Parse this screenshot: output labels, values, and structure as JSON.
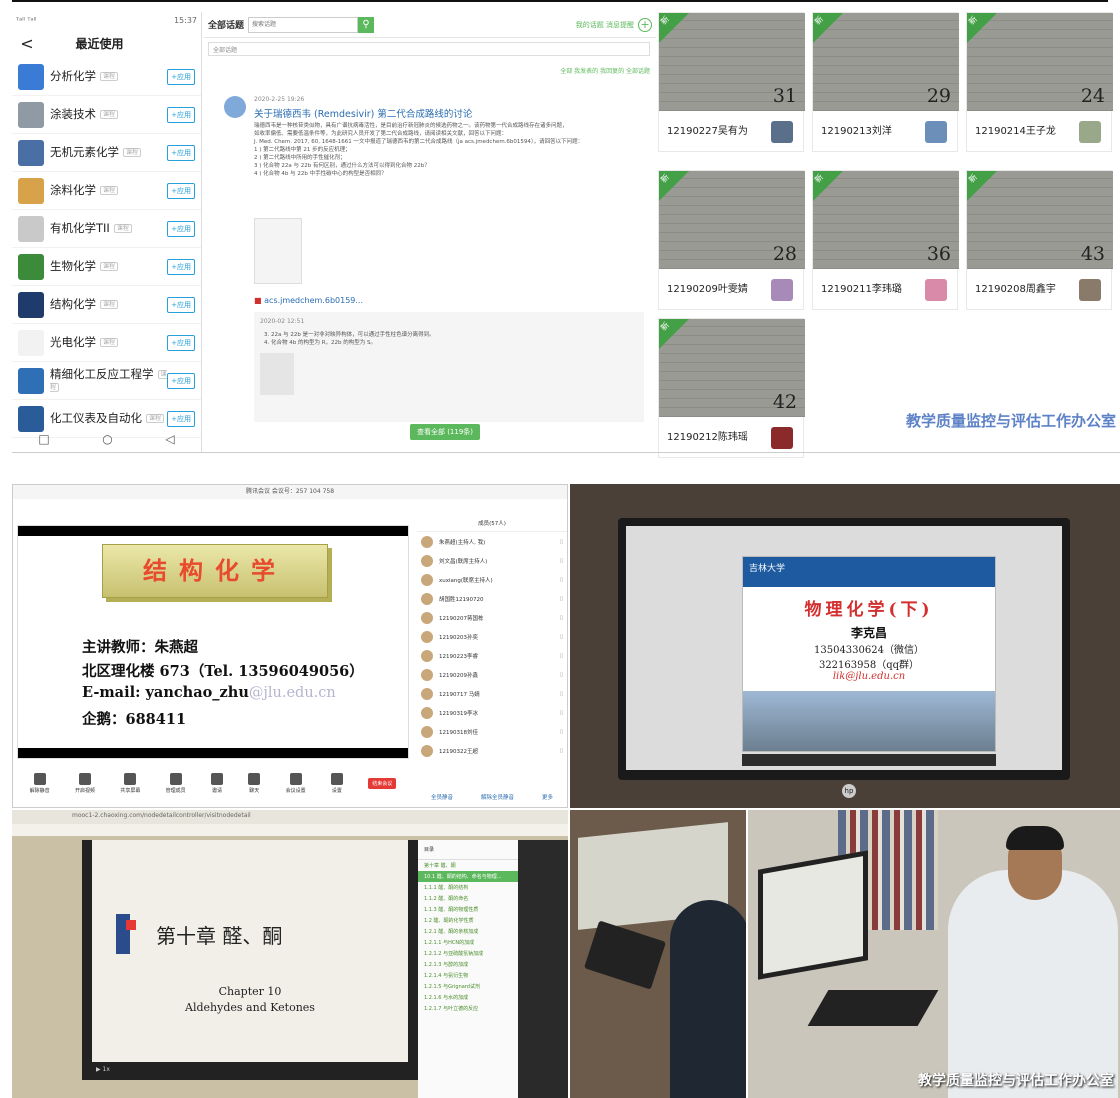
{
  "phone": {
    "status_left": "ᵀᵃˡˡ ᵀᵃˡˡ",
    "status_right": "15:37",
    "title": "最近使用",
    "back": "<",
    "items": [
      {
        "name": "分析化学",
        "tag": "课程",
        "button": "+应用",
        "color": "#3a7bd5"
      },
      {
        "name": "涂装技术",
        "tag": "课程",
        "button": "+应用",
        "color": "#8f9aa5"
      },
      {
        "name": "无机元素化学",
        "tag": "课程",
        "button": "+应用",
        "color": "#4a6fa5"
      },
      {
        "name": "涂料化学",
        "tag": "课程",
        "button": "+应用",
        "color": "#d8a24a"
      },
      {
        "name": "有机化学TII",
        "tag": "课程",
        "button": "+应用",
        "color": "#c9c9c9"
      },
      {
        "name": "生物化学",
        "tag": "课程",
        "button": "+应用",
        "color": "#3b8b3b"
      },
      {
        "name": "结构化学",
        "tag": "课程",
        "button": "+应用",
        "color": "#1f3b6b"
      },
      {
        "name": "光电化学",
        "tag": "课程",
        "button": "+应用",
        "color": "#f2f2f2"
      },
      {
        "name": "精细化工反应工程学",
        "tag": "课程",
        "button": "+应用",
        "color": "#2f6fb5"
      },
      {
        "name": "化工仪表及自动化",
        "tag": "课程",
        "button": "+应用",
        "color": "#2a5c9a"
      }
    ],
    "nav": [
      "□",
      "○",
      "◁"
    ]
  },
  "discussion": {
    "label": "全部话题",
    "search_placeholder": "搜索话题",
    "search_icon": "search-icon",
    "right_links": "我的话题  消息提醒",
    "sub_label": "全部话题",
    "filters": "全部  我发表的  我回复的  全部话题",
    "post": {
      "meta": "2020-2-25 19:26",
      "title": "关于瑞德西韦 (Remdesivir) 第二代合成路线的讨论",
      "body_lines": [
        "瑞德西韦是一种核苷类似物，具有广谱抗病毒活性，是目前治疗新冠肺炎的候选药物之一。该药物第一代合成路线存在诸多问题，",
        "如收率偏低、需要低温条件等，为此研究人员开发了第二代合成路线，请阅读相关文献，回答以下问题：",
        "J. Med. Chem. 2017, 60, 1648-1661 一文中报道了瑞德西韦的第二代合成路线（ja acs.jmedchem.6b01594），请回答以下问题：",
        "1 ) 第二代路线中第 21 步的反应机理；",
        "2 ) 第二代路线中所用的手性催化剂；",
        "3 ) 化合物 22a 与 22b 有何区别，通过什么方法可以得到化合物 22b？",
        "4 ) 化合物 4b 与 22b 中手性碳中心的构型是否相同？"
      ],
      "link": "acs.jmedchem.6b0159..."
    },
    "reply": {
      "meta": "2020-02 12:51",
      "lines": [
        "3. 22a 与 22b 是一对非对映异构体，可以通过手性柱色谱分离得到。",
        "4. 化合物 4b 的构型为 R，22b 的构型为 S。"
      ]
    },
    "more_button": "查看全部 (119条)"
  },
  "homework": {
    "ribbon": "新",
    "cards": [
      {
        "name": "12190227吴有为",
        "score": "31",
        "thumb": "#5a6f8a"
      },
      {
        "name": "12190213刘洋",
        "score": "29",
        "thumb": "#6b8fb8"
      },
      {
        "name": "12190214王子龙",
        "score": "24",
        "thumb": "#9aa88a"
      },
      {
        "name": "12190209叶雯婧",
        "score": "28",
        "thumb": "#a88ab8"
      },
      {
        "name": "12190211李玮璐",
        "score": "36",
        "thumb": "#d88aa8"
      },
      {
        "name": "12190208周鑫宇",
        "score": "43",
        "thumb": "#8a7a6a"
      },
      {
        "name": "12190212陈玮瑶",
        "score": "42",
        "thumb": "#8a2a2a"
      }
    ],
    "brand": "教学质量监控与评估工作办公室"
  },
  "lecture1": {
    "window_title": "腾讯会议  会议号：257 104 758",
    "slide_title": "结构化学",
    "teacher": "主讲教师：朱燕超",
    "office": "北区理化楼 673（Tel. 13596049056）",
    "email_user": "E-mail: yanchao_zhu",
    "email_domain": "@jlu.edu.cn",
    "qq": "企鹅：688411",
    "toolbar": [
      "解除静音",
      "开启视频",
      "共享屏幕",
      "管理成员",
      "邀请",
      "聊天",
      "会议设置",
      "设置"
    ],
    "end_button": "结束会议",
    "participants_header": "成员(57人)",
    "participants": [
      {
        "name": "朱燕超(主持人, 我)",
        "status": "▯"
      },
      {
        "name": "刘文昌(联席主持人)",
        "status": "▯"
      },
      {
        "name": "xuxiang(联席主持人)",
        "status": "▯"
      },
      {
        "name": "胡国胜12190720",
        "status": "▯"
      },
      {
        "name": "12190207蒋国栋",
        "status": "▯"
      },
      {
        "name": "12190203孙奕",
        "status": "▯"
      },
      {
        "name": "12190223李睿",
        "status": "▯"
      },
      {
        "name": "12190209孙鑫",
        "status": "▯"
      },
      {
        "name": "12190717 马婧",
        "status": "▯"
      },
      {
        "name": "12190319李冰",
        "status": "▯"
      },
      {
        "name": "12190318刘佳",
        "status": "▯"
      },
      {
        "name": "12190322王超",
        "status": "▯"
      }
    ],
    "footer": [
      "全员静音",
      "解除全员静音",
      "更多"
    ]
  },
  "lecture2": {
    "header": "吉林大学",
    "title": "物理化学(下)",
    "teacher": "李克昌",
    "phone": "13504330624（微信）",
    "qq": "322163958（qq群）",
    "email": "lik@jlu.edu.cn",
    "logo": "hp"
  },
  "lecture3": {
    "url": "mooc1-2.chaoxing.com/nodedetailcontroller/visitnodedetail",
    "chapter": "第十章  醛、酮",
    "english": "Chapter 10\nAldehydes and Ketones",
    "toc_header": "目录",
    "toc": [
      "第十章 醛、酮",
      "10.1 醛、酮的结构、命名与物理...",
      "1.1.1 醛、酮的结构",
      "1.1.2 醛、酮的命名",
      "1.1.3 醛、酮的物理性质",
      "1.2 醛、酮的化学性质",
      "1.2.1 醛、酮的亲核加成",
      "1.2.1.1 与HCN的加成",
      "1.2.1.2 与亚硫酸氢钠加成",
      "1.2.1.3 与醇的加成",
      "1.2.1.4 与氨衍生物",
      "1.2.1.5 与Grignard试剂",
      "1.2.1.6 与水的加成",
      "1.2.1.7 与叶立德的反应"
    ]
  },
  "photo_brand": "教学质量监控与评估工作办公室"
}
